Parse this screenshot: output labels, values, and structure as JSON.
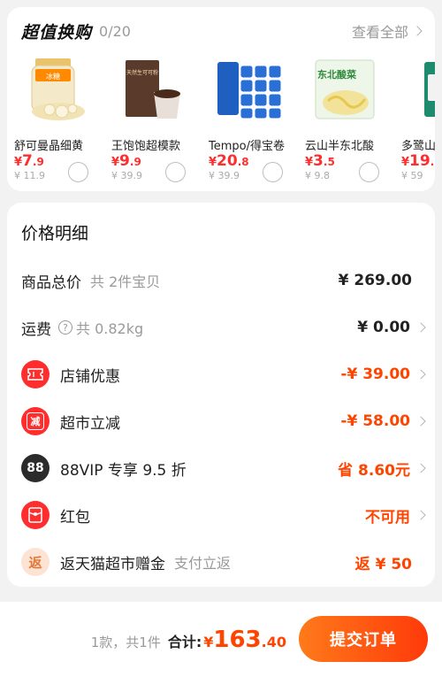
{
  "exchange": {
    "title": "超值换购",
    "count": "0/20",
    "view_all": "查看全部",
    "products": [
      {
        "name": "舒可曼晶细黄",
        "sym": "¥",
        "price_int": "7",
        "price_dec": ".9",
        "orig": "¥ 11.9"
      },
      {
        "name": "王饱饱超模款",
        "sym": "¥",
        "price_int": "9",
        "price_dec": ".9",
        "orig": "¥ 39.9"
      },
      {
        "name": "Tempo/得宝卷",
        "sym": "¥",
        "price_int": "20",
        "price_dec": ".8",
        "orig": "¥ 39.9"
      },
      {
        "name": "云山半东北酸",
        "sym": "¥",
        "price_int": "3",
        "price_dec": ".5",
        "orig": "¥ 9.8"
      },
      {
        "name": "多鹭山",
        "sym": "¥",
        "price_int": "19",
        "price_dec": ".",
        "orig": "¥ 59"
      }
    ],
    "image_text": {
      "jar": "冰糖",
      "box": "天然生可可粉",
      "sauerkraut": "东北酸菜"
    }
  },
  "detail": {
    "title": "价格明细",
    "rows": [
      {
        "label": "商品总价",
        "sub": "共 2件宝贝",
        "value": "¥ 269.00"
      },
      {
        "label": "运费",
        "sub": "共 0.82kg",
        "value": "¥ 0.00"
      },
      {
        "label": "店铺优惠",
        "value": "-¥ 39.00"
      },
      {
        "label": "超市立减",
        "value": "-¥ 58.00",
        "icon_text": "减"
      },
      {
        "label": "88VIP 专享 9.5 折",
        "value": "省 8.60元",
        "icon_text": "88"
      },
      {
        "label": "红包",
        "value": "不可用"
      },
      {
        "label": "返天猫超市赠金",
        "sub": "支付立返",
        "value": "返 ¥ 50",
        "icon_text": "返"
      }
    ],
    "help_icon_text": "?"
  },
  "footer": {
    "items_text": "1款，共1件",
    "total_label": "合计:",
    "total_symbol": "¥",
    "total_int": "163",
    "total_dec": ".40",
    "submit_label": "提交订单"
  },
  "colors": {
    "accent": "#ff4400",
    "price_red": "#ff2e2e",
    "submit_start": "#ff7a1a",
    "submit_end": "#ff3a0a"
  }
}
